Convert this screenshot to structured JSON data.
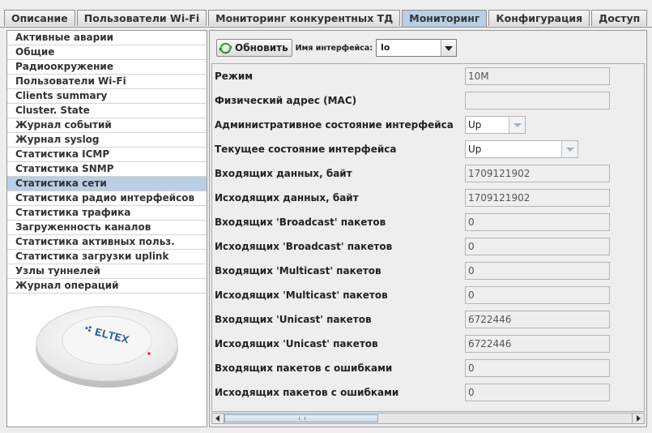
{
  "tabs": [
    {
      "label": "Описание",
      "active": false
    },
    {
      "label": "Пользователи Wi-Fi",
      "active": false
    },
    {
      "label": "Мониторинг конкурентных ТД",
      "active": false
    },
    {
      "label": "Мониторинг",
      "active": true
    },
    {
      "label": "Конфигурация",
      "active": false
    },
    {
      "label": "Доступ",
      "active": false
    }
  ],
  "sidebar": {
    "items": [
      {
        "label": "Активные аварии"
      },
      {
        "label": "Общие"
      },
      {
        "label": "Радиоокружение"
      },
      {
        "label": "Пользователи Wi-Fi"
      },
      {
        "label": "Clients summary"
      },
      {
        "label": "Cluster. State"
      },
      {
        "label": "Журнал событий"
      },
      {
        "label": "Журнал syslog"
      },
      {
        "label": "Статистика ICMP"
      },
      {
        "label": "Статистика SNMP"
      },
      {
        "label": "Статистика сети",
        "selected": true
      },
      {
        "label": "Статистика радио интерфейсов"
      },
      {
        "label": "Статистика трафика"
      },
      {
        "label": "Загруженность каналов"
      },
      {
        "label": "Статистика активных польз."
      },
      {
        "label": "Статистика загрузки uplink"
      },
      {
        "label": "Узлы туннелей"
      },
      {
        "label": "Журнал операций"
      }
    ],
    "device_logo_text": "ELTEX"
  },
  "toolbar": {
    "refresh_label": "Обновить",
    "iface_label": "Имя интерфейса:",
    "iface_value": "lo"
  },
  "stats": {
    "rows": [
      {
        "label": "Режим",
        "value": "10M"
      },
      {
        "label": "Физический адрес (MAC)",
        "value": ""
      },
      {
        "label": "Административное состояние интерфейса",
        "value": "Up"
      },
      {
        "label": "Текущее состояние интерфейса",
        "value": "Up"
      },
      {
        "label": "Входящих данных, байт",
        "value": "1709121902"
      },
      {
        "label": "Исходящих данных, байт",
        "value": "1709121902"
      },
      {
        "label": "Входящих 'Broadcast' пакетов",
        "value": "0"
      },
      {
        "label": "Исходящих 'Broadcast' пакетов",
        "value": "0"
      },
      {
        "label": "Входящих 'Multicast' пакетов",
        "value": "0"
      },
      {
        "label": "Исходящих 'Multicast' пакетов",
        "value": "0"
      },
      {
        "label": "Входящих 'Unicast' пакетов",
        "value": "6722446"
      },
      {
        "label": "Исходящих 'Unicast' пакетов",
        "value": "6722446"
      },
      {
        "label": "Входящих пакетов с ошибками",
        "value": "0"
      },
      {
        "label": "Исходящих пакетов с ошибками",
        "value": "0"
      }
    ]
  },
  "colors": {
    "selection": "#b8cfe5",
    "background": "#eeeeee",
    "refresh_icon": "#3aa33a"
  }
}
